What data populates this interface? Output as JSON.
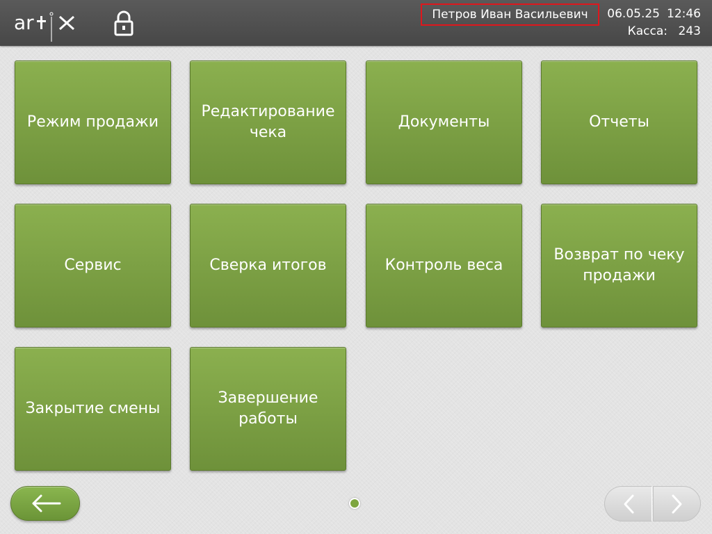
{
  "header": {
    "logo_text": "artix",
    "user_name": "Петров Иван Васильевич",
    "date": "06.05.25",
    "time": "12:46",
    "kassa_label": "Касса:",
    "kassa_number": "243"
  },
  "menu": {
    "items": [
      {
        "label": "Режим продажи"
      },
      {
        "label": "Редактирование чека"
      },
      {
        "label": "Документы"
      },
      {
        "label": "Отчеты"
      },
      {
        "label": "Сервис"
      },
      {
        "label": "Сверка итогов"
      },
      {
        "label": "Контроль веса"
      },
      {
        "label": "Возврат по чеку продажи"
      },
      {
        "label": "Закрытие смены"
      },
      {
        "label": "Завершение работы"
      }
    ]
  },
  "footer": {
    "back_icon": "arrow-left-icon",
    "prev_icon": "chevron-left-icon",
    "next_icon": "chevron-right-icon",
    "current_page_dot": "active"
  },
  "colors": {
    "header_bg": "#4f4f4f",
    "tile_green": "#7ea244",
    "highlight_border": "#e0161c",
    "background": "#e3e3e3"
  }
}
